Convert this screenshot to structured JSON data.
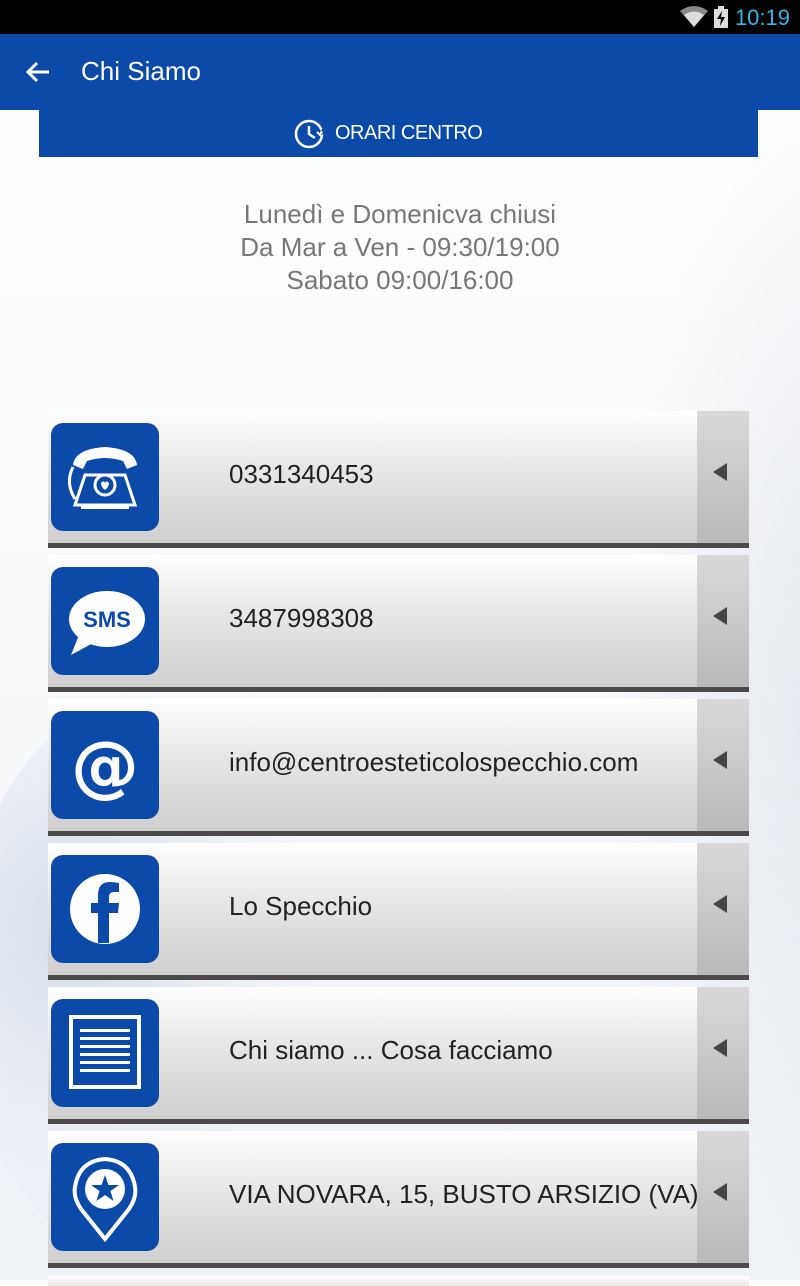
{
  "status": {
    "time": "10:19"
  },
  "appbar": {
    "title": "Chi Siamo",
    "back_icon": "arrow-back-icon"
  },
  "hours_bar": {
    "label": "ORARI CENTRO",
    "icon": "clock-icon"
  },
  "hours": {
    "line1": "Lunedì e Domenicva chiusi",
    "line2": "Da Mar a Ven - 09:30/19:00",
    "line3": "Sabato 09:00/16:00"
  },
  "rows": [
    {
      "label": "0331340453",
      "icon": "phone-icon"
    },
    {
      "label": "3487998308",
      "icon": "sms-icon"
    },
    {
      "label": "info@centroesteticolospecchio.com",
      "icon": "email-icon"
    },
    {
      "label": "Lo Specchio",
      "icon": "facebook-icon"
    },
    {
      "label": "Chi siamo ... Cosa facciamo",
      "icon": "document-icon"
    },
    {
      "label": "VIA NOVARA, 15, BUSTO ARSIZIO (VA)",
      "icon": "map-pin-icon"
    }
  ],
  "colors": {
    "primary": "#0b4aa8",
    "statusbar": "#000000",
    "accent": "#33b5e5"
  }
}
